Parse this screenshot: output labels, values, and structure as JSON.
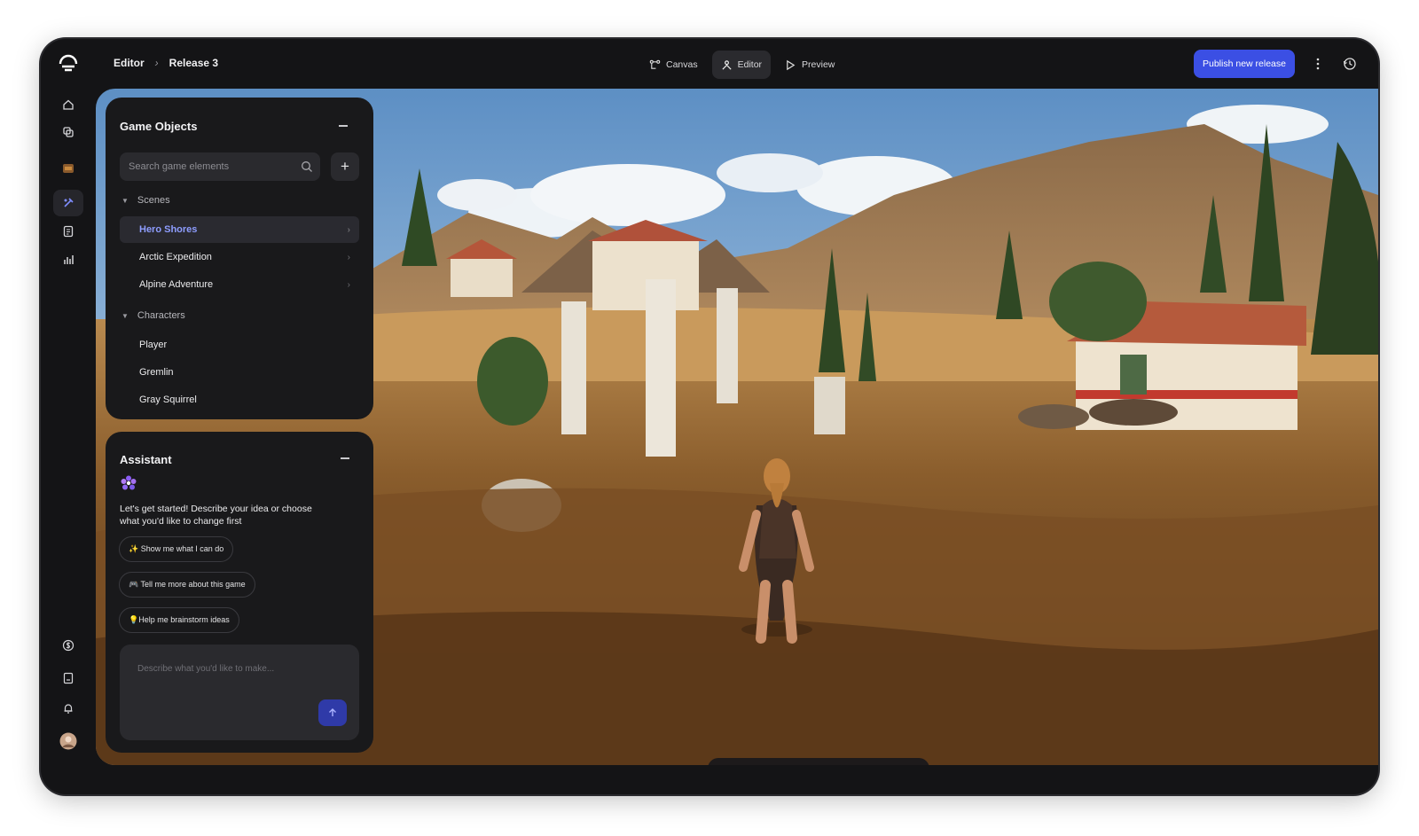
{
  "breadcrumb": {
    "root": "Editor",
    "separator": "›",
    "current": "Release 3"
  },
  "modes": [
    {
      "label": "Canvas",
      "icon": "canvas-icon",
      "active": false
    },
    {
      "label": "Editor",
      "icon": "editor-icon",
      "active": true
    },
    {
      "label": "Preview",
      "icon": "play-icon",
      "active": false
    }
  ],
  "publish_label": "Publish new release",
  "rail": [
    "home-icon",
    "layers-icon",
    "game-thumbnail-icon",
    "editor-tools-icon",
    "document-icon",
    "analytics-icon",
    "currency-icon",
    "library-icon",
    "bell-icon",
    "avatar"
  ],
  "game_objects": {
    "title": "Game Objects",
    "search_placeholder": "Search game elements",
    "add_label": "+",
    "groups": [
      {
        "label": "Scenes",
        "items": [
          "Hero Shores",
          "Arctic Expedition",
          "Alpine Adventure"
        ]
      },
      {
        "label": "Characters",
        "items": [
          "Player",
          "Gremlin",
          "Gray Squirrel"
        ]
      }
    ],
    "selected": "Hero Shores"
  },
  "assistant": {
    "title": "Assistant",
    "message": "Let's get started! Describe your idea or choose what you'd like to change first",
    "chips": [
      "✨ Show me what I can do",
      "🎮 Tell me more about this game",
      "💡Help me brainstorm ideas"
    ],
    "composer_placeholder": "Describe what you'd like to make..."
  },
  "toolbar": [
    "hand-icon",
    "select-icon",
    "move-icon",
    "rotate-icon",
    "scale-icon",
    "components-icon"
  ],
  "colors": {
    "accent": "#3b4fe4",
    "selected_text": "#8e9dff",
    "panel": "#19191b",
    "frame": "#141416"
  }
}
